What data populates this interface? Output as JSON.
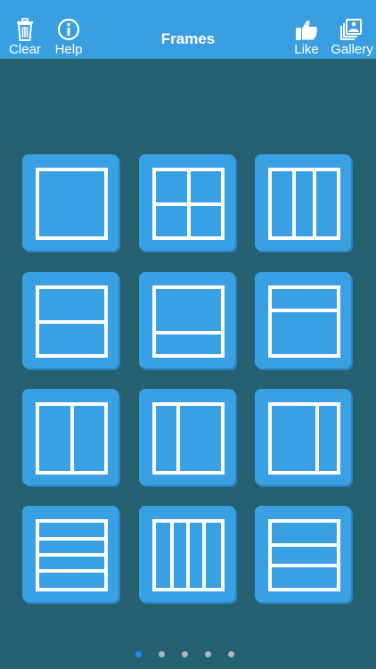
{
  "header": {
    "title": "Frames",
    "clear_label": "Clear",
    "help_label": "Help",
    "like_label": "Like",
    "gallery_label": "Gallery"
  },
  "colors": {
    "toolbar": "#3a9fe0",
    "background": "#24606f",
    "tile": "#3aa0e4",
    "active_dot": "#1b8cf0"
  },
  "frames": [
    {
      "id": "frame-single",
      "layout": "single"
    },
    {
      "id": "frame-grid-2x2",
      "layout": "2x2 grid"
    },
    {
      "id": "frame-three-columns",
      "layout": "3 columns"
    },
    {
      "id": "frame-two-rows-equal",
      "layout": "2 rows"
    },
    {
      "id": "frame-two-rows-top-large",
      "layout": "2 rows, top larger"
    },
    {
      "id": "frame-two-rows-bottom-large",
      "layout": "2 rows, bottom larger"
    },
    {
      "id": "frame-two-columns-equal",
      "layout": "2 columns"
    },
    {
      "id": "frame-two-columns-right-large",
      "layout": "2 columns, right larger"
    },
    {
      "id": "frame-two-columns-left-large",
      "layout": "2 columns, left larger"
    },
    {
      "id": "frame-four-rows",
      "layout": "4 rows"
    },
    {
      "id": "frame-four-columns",
      "layout": "4 columns"
    },
    {
      "id": "frame-three-rows",
      "layout": "3 rows"
    }
  ],
  "pagination": {
    "total": 5,
    "current": 1
  }
}
